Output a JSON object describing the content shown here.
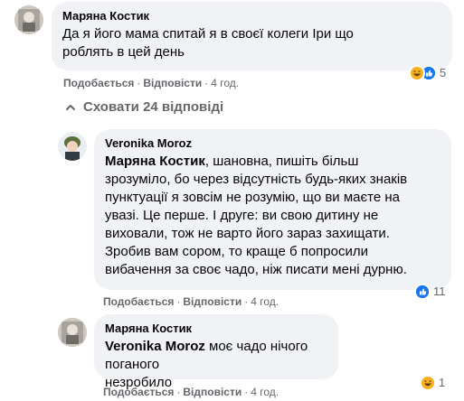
{
  "comments": [
    {
      "author": "Маряна Костик",
      "mention": "",
      "text": "Да я його мама спитай я в своєї колеги Іри що роблять в цей день",
      "lines": [
        "Да я його мама спитай я в своєї колеги Іри що",
        "роблять в цей день"
      ],
      "actions": {
        "like": "Подобається",
        "reply": "Відповісти",
        "time": "4 год."
      },
      "reaction_count": "5",
      "reaction_icons": [
        "haha-icon",
        "like-icon"
      ]
    },
    {
      "author": "Veronika Moroz",
      "mention": "Маряна Костик",
      "lines": [
        ", шановна, пишіть більш",
        "зрозуміло, бо через відсутність будь-яких знаків",
        "пунктуації я зовсім не розумію, що ви маєте на",
        "увазі. Це перше. І друге: ви свою дитину не",
        "виховали, тож не варто його зараз захищати.",
        "Зробив вам сором, то краще б попросили",
        "вибачення за своє чадо, ніж писати мені дурню."
      ],
      "actions": {
        "like": "Подобається",
        "reply": "Відповісти",
        "time": "4 год."
      },
      "reaction_count": "11",
      "reaction_icons": [
        "like-icon"
      ]
    },
    {
      "author": "Маряна Костик",
      "mention": "Veronika Moroz",
      "lines": [
        " моє чадо нічого поганого",
        "незробило"
      ],
      "actions": {
        "like": "Подобається",
        "reply": "Відповісти",
        "time": "4 год."
      },
      "reaction_count": "1",
      "reaction_icons": [
        "haha-icon"
      ]
    }
  ],
  "hide_replies_label": "Сховати 24 відповіді",
  "colors": {
    "bubble": "#f0f2f5",
    "secondary_text": "#65676b",
    "like_blue": "#1877f2",
    "haha_yellow": "#f7b125"
  }
}
